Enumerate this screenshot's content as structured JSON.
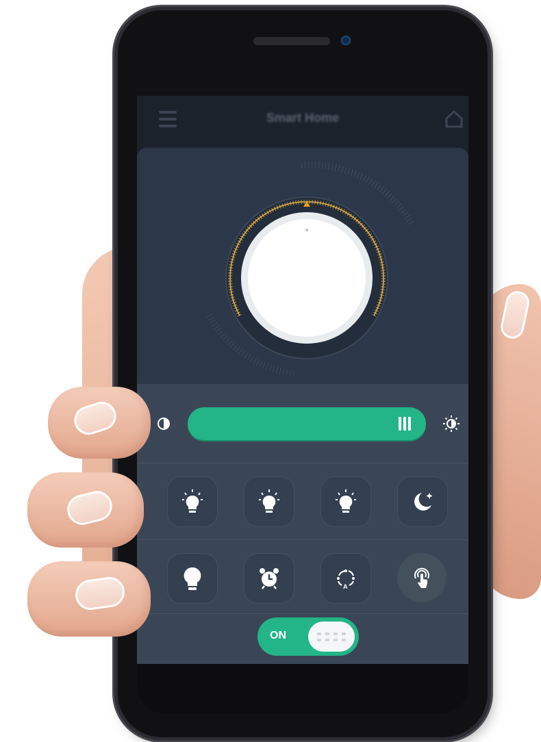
{
  "app": {
    "title": "Smart Home"
  },
  "colors": {
    "accent": "#23b487",
    "panel": "#2c3849",
    "dial_ring": "#d6a23c"
  },
  "brightness": {
    "level": 0.93
  },
  "scenes": [
    {
      "icon": "bulb-icon"
    },
    {
      "icon": "bulb-icon"
    },
    {
      "icon": "bulb-icon"
    },
    {
      "icon": "moon-icon"
    },
    {
      "icon": "bulb-filled-icon"
    },
    {
      "icon": "alarm-clock-icon"
    },
    {
      "icon": "auto-cycle-icon"
    },
    {
      "icon": "touch-icon"
    }
  ],
  "power": {
    "label": "ON",
    "state": "on"
  }
}
